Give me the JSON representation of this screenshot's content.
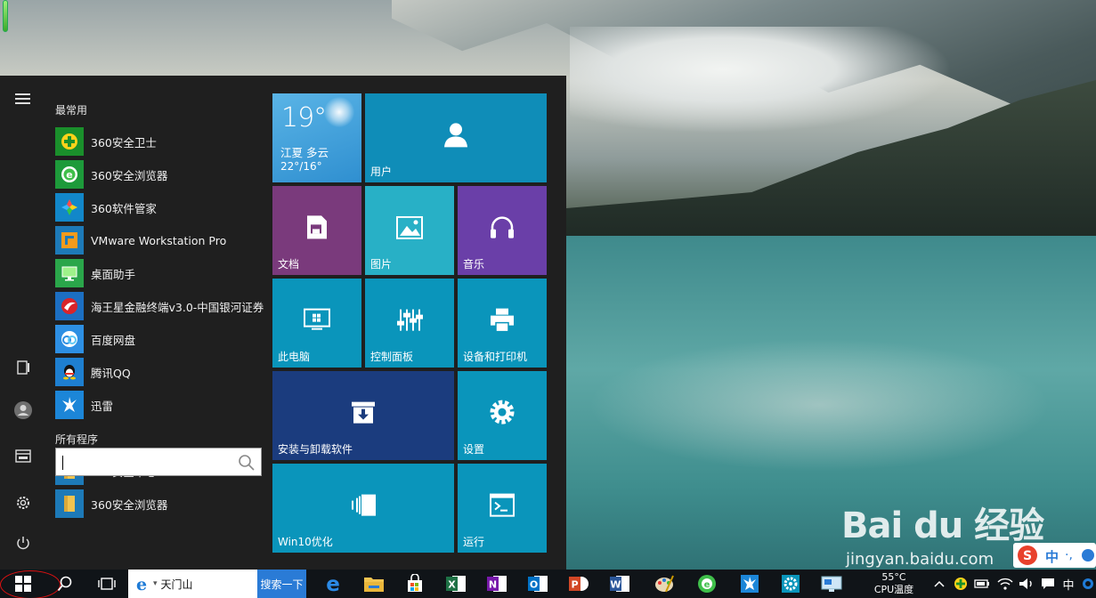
{
  "start_menu": {
    "most_used_label": "最常用",
    "all_programs_label": "所有程序",
    "most_used": [
      {
        "name": "360安全卫士",
        "icon": "360-safeguard-icon"
      },
      {
        "name": "360安全浏览器",
        "icon": "360-browser-icon"
      },
      {
        "name": "360软件管家",
        "icon": "360-software-manager-icon"
      },
      {
        "name": "VMware Workstation Pro",
        "icon": "vmware-icon"
      },
      {
        "name": "桌面助手",
        "icon": "desktop-assistant-icon"
      },
      {
        "name": "海王星金融终端v3.0-中国银河证券",
        "icon": "neptune-finance-icon"
      },
      {
        "name": "百度网盘",
        "icon": "baidu-netdisk-icon"
      },
      {
        "name": "腾讯QQ",
        "icon": "qq-icon"
      },
      {
        "name": "迅雷",
        "icon": "xunlei-icon"
      }
    ],
    "all_programs": [
      {
        "name": "360安全中心",
        "icon": "folder-icon"
      },
      {
        "name": "360安全浏览器",
        "icon": "folder-icon"
      }
    ],
    "rail": [
      "menu-icon",
      "tablet-mode-icon",
      "user-icon",
      "explorer-icon",
      "settings-icon",
      "power-icon"
    ]
  },
  "tiles": {
    "weather": {
      "temp": "19°",
      "city": "江夏 多云",
      "range": "22°/16°"
    },
    "user": "用户",
    "documents": "文档",
    "pictures": "图片",
    "music": "音乐",
    "this_pc": "此电脑",
    "control_panel": "控制面板",
    "devices_printers": "设备和打印机",
    "install_uninstall": "安装与卸载软件",
    "settings": "设置",
    "win10_optimize": "Win10优化",
    "run": "运行"
  },
  "taskbar": {
    "ie_search_text": "天门山",
    "ie_search_button": "搜索一下",
    "cpu_temp_value": "55°C",
    "cpu_temp_label": "CPU温度",
    "ime": "中",
    "apps": [
      "edge-icon",
      "file-explorer-icon",
      "store-icon",
      "excel-icon",
      "onenote-icon",
      "outlook-icon",
      "powerpoint-icon",
      "word-icon",
      "paint-icon",
      "360-browser-icon",
      "xunlei-icon",
      "settings-icon",
      "remote-desktop-icon"
    ]
  },
  "watermark": {
    "brand": "Bai du 经验",
    "url": "jingyan.baidu.com"
  },
  "sogou": {
    "text": "中"
  }
}
